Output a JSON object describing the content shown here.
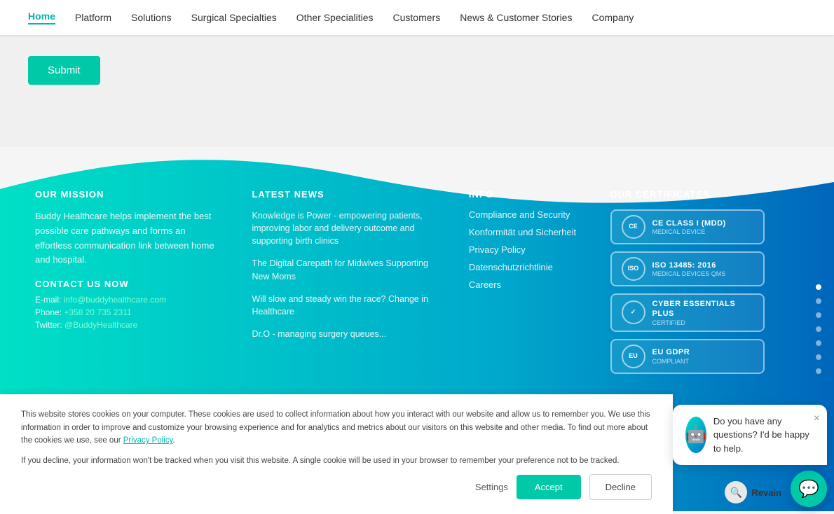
{
  "navbar": {
    "items": [
      {
        "label": "Home",
        "active": true
      },
      {
        "label": "Platform",
        "active": false
      },
      {
        "label": "Solutions",
        "active": false
      },
      {
        "label": "Surgical Specialties",
        "active": false
      },
      {
        "label": "Other Specialities",
        "active": false
      },
      {
        "label": "Customers",
        "active": false
      },
      {
        "label": "News & Customer Stories",
        "active": false
      },
      {
        "label": "Company",
        "active": false
      }
    ]
  },
  "submit_button": "Submit",
  "footer": {
    "mission": {
      "heading": "OUR MISSION",
      "text": "Buddy Healthcare helps implement the best possible care pathways and forms an effortless communication link between home and hospital.",
      "contact_heading": "CONTACT US NOW",
      "email_label": "E-mail:",
      "email_value": "info@buddyhealthcare.com",
      "phone_label": "Phone:",
      "phone_value": "+358 20 735 2311",
      "twitter_label": "Twitter:",
      "twitter_value": "@BuddyHealthcare"
    },
    "news": {
      "heading": "LATEST NEWS",
      "items": [
        "Knowledge is Power - empowering patients, improving labor and delivery outcome and supporting birth clinics",
        "The Digital Carepath for Midwives Supporting New Moms",
        "Will slow and steady win the race? Change in Healthcare",
        "Dr.O - managing surgery queues..."
      ]
    },
    "info": {
      "heading": "INFO",
      "links": [
        "Compliance and Security",
        "Konformität und Sicherheit",
        "Privacy Policy",
        "Datenschutzrichtlinie",
        "Careers"
      ]
    },
    "certificates": {
      "heading": "OUR CERTIFICATES",
      "items": [
        {
          "icon": "CE",
          "sub": "CLASS I",
          "text": "CE CLASS I (MDD)",
          "detail": "MEDICAL DEVICE"
        },
        {
          "icon": "ISO",
          "sub": "",
          "text": "ISO 13485: 2016",
          "detail": "MEDICAL DEVICES QMS"
        },
        {
          "icon": "✓",
          "sub": "",
          "text": "CYBER ESSENTIALS PLUS",
          "detail": "CERTIFIED"
        },
        {
          "icon": "EU",
          "sub": "",
          "text": "EU GDPR",
          "detail": "COMPLIANT"
        }
      ]
    }
  },
  "dots": [
    1,
    2,
    3,
    4,
    5,
    6,
    7
  ],
  "active_dot": 1,
  "cookie": {
    "text1": "This website stores cookies on your computer. These cookies are used to collect information about how you interact with our website and allow us to remember you. We use this information in order to improve and customize your browsing experience and for analytics and metrics about our visitors on this website and other media. To find out more about the cookies we use, see our",
    "privacy_link": "Privacy Policy",
    "text2": ".",
    "text3": "If you decline, your information won't be tracked when you visit this website. A single cookie will be used in your browser to remember your preference not to be tracked.",
    "settings_label": "Settings",
    "accept_label": "Accept",
    "decline_label": "Decline"
  },
  "chat": {
    "message": "Do you have any questions? I'd be happy to help.",
    "close_icon": "×"
  },
  "revain": {
    "label": "Revain"
  }
}
